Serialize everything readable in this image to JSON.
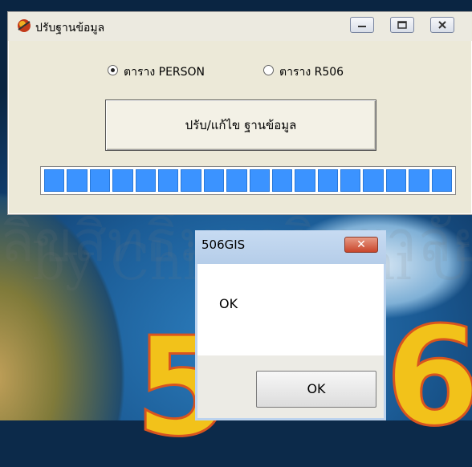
{
  "window": {
    "title": "ปรับฐานข้อมูล",
    "radio_person": "ตาราง PERSON",
    "radio_r506": "ตาราง R506",
    "action_button": "ปรับ/แก้ไข ฐานข้อมูล",
    "progress_segments": 18,
    "progress_fraction": 1.0,
    "selected_table": "PERSON"
  },
  "dialog": {
    "title": "506GIS",
    "close_glyph": "✕",
    "message": "OK",
    "ok_button": "OK"
  },
  "background": {
    "logo_digits": [
      "5",
      "6"
    ]
  },
  "colors": {
    "progress": "#3b93ff",
    "dialog_close": "#c9462c",
    "logo": "#f2c21a"
  }
}
